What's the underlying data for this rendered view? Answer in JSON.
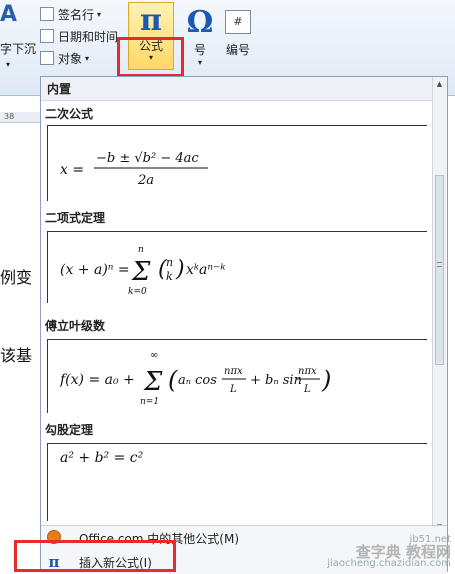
{
  "ribbon": {
    "partial_left_label": "A",
    "partial_btn_label": "字下沉",
    "signature_line": "签名行",
    "datetime": "日期和时间",
    "object": "对象",
    "formula_label": "公式",
    "symbol_label": "符号",
    "symbol_partial": "号",
    "number_label": "编号",
    "formula_glyph": "π",
    "symbol_glyph": "Ω",
    "number_glyph": "#"
  },
  "document": {
    "ruler_number": "38",
    "text1": "例变",
    "text2": "该基"
  },
  "gallery": {
    "header": "内置",
    "sections": [
      {
        "title": "二次公式",
        "equation": "x = (−b ± √(b² − 4ac)) / 2a"
      },
      {
        "title": "二项式定理",
        "equation": "(x + a)ⁿ = Σ (n k) xᵏaⁿ⁻ᵏ"
      },
      {
        "title": "傅立叶级数",
        "equation": "f(x) = a₀ + Σ (aₙ cos nπx/L + bₙ sin nπx/L)"
      },
      {
        "title": "勾股定理",
        "equation": "a² + b² = c²"
      }
    ],
    "footer": {
      "more": "Office.com 中的其他公式(M)",
      "insert": "插入新公式(I)"
    }
  },
  "watermark": {
    "line1": "jb51.net",
    "line2": "查字典 教程网",
    "line3": "jiaocheng.chazidian.com"
  },
  "colors": {
    "accent": "#1b57b3",
    "highlight": "#e52b2b"
  }
}
